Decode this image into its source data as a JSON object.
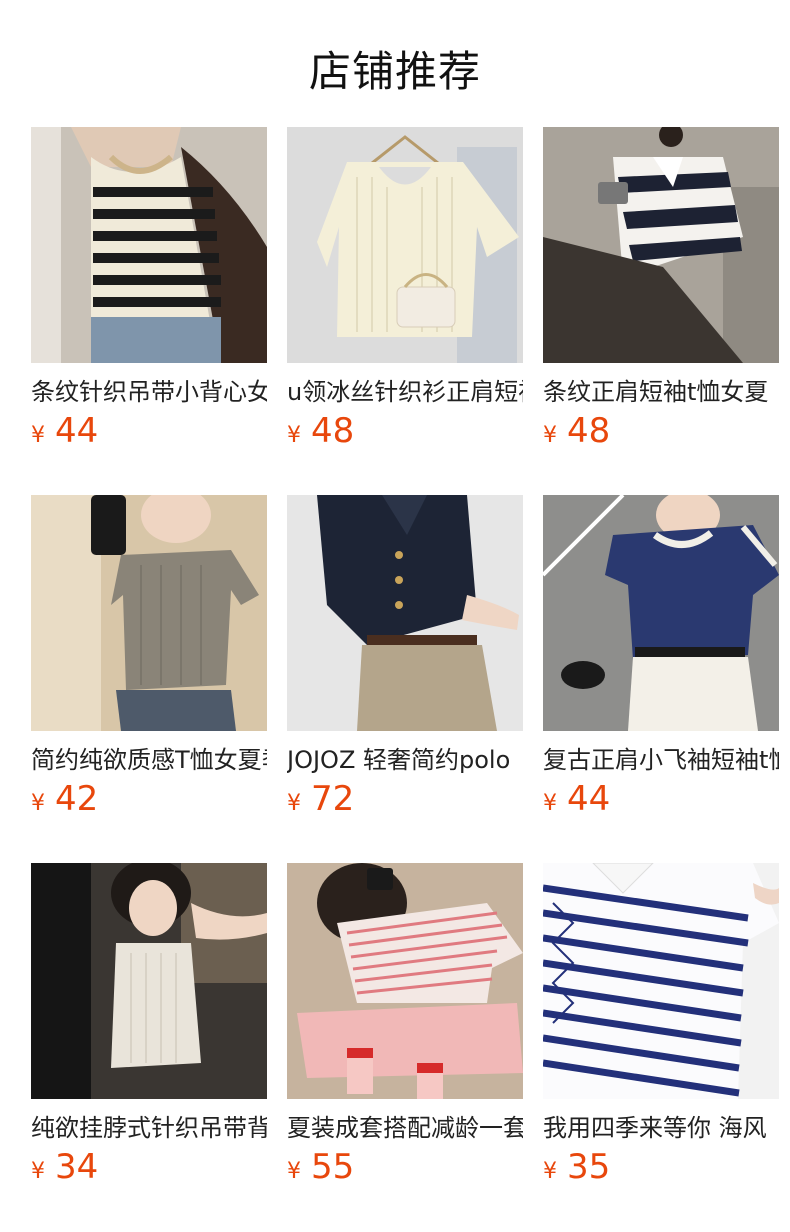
{
  "header": {
    "title": "店铺推荐"
  },
  "colors": {
    "price": "#e8470c"
  },
  "products": [
    {
      "title": "条纹针织吊带小背心女",
      "currency": "¥",
      "price": "44",
      "image": "black-cream-striped-knit-vest"
    },
    {
      "title": "u领冰丝针织衫正肩短袖",
      "currency": "¥",
      "price": "48",
      "image": "cream-knit-top-on-hanger"
    },
    {
      "title": "条纹正肩短袖t恤女夏",
      "currency": "¥",
      "price": "48",
      "image": "navy-white-striped-polo"
    },
    {
      "title": "简约纯欲质感T恤女夏季",
      "currency": "¥",
      "price": "42",
      "image": "grey-cropped-tee"
    },
    {
      "title": "JOJOZ 轻奢简约polo",
      "currency": "¥",
      "price": "72",
      "image": "navy-knit-polo-cardigan"
    },
    {
      "title": "复古正肩小飞袖短袖t恤",
      "currency": "¥",
      "price": "44",
      "image": "navy-tee-white-trim"
    },
    {
      "title": "纯欲挂脖式针织吊带背心",
      "currency": "¥",
      "price": "34",
      "image": "cream-halter-knit-top"
    },
    {
      "title": "夏装成套搭配减龄一套",
      "currency": "¥",
      "price": "55",
      "image": "pink-striped-set"
    },
    {
      "title": "我用四季来等你 海风",
      "currency": "¥",
      "price": "35",
      "image": "blue-white-striped-lace-up-top"
    }
  ]
}
